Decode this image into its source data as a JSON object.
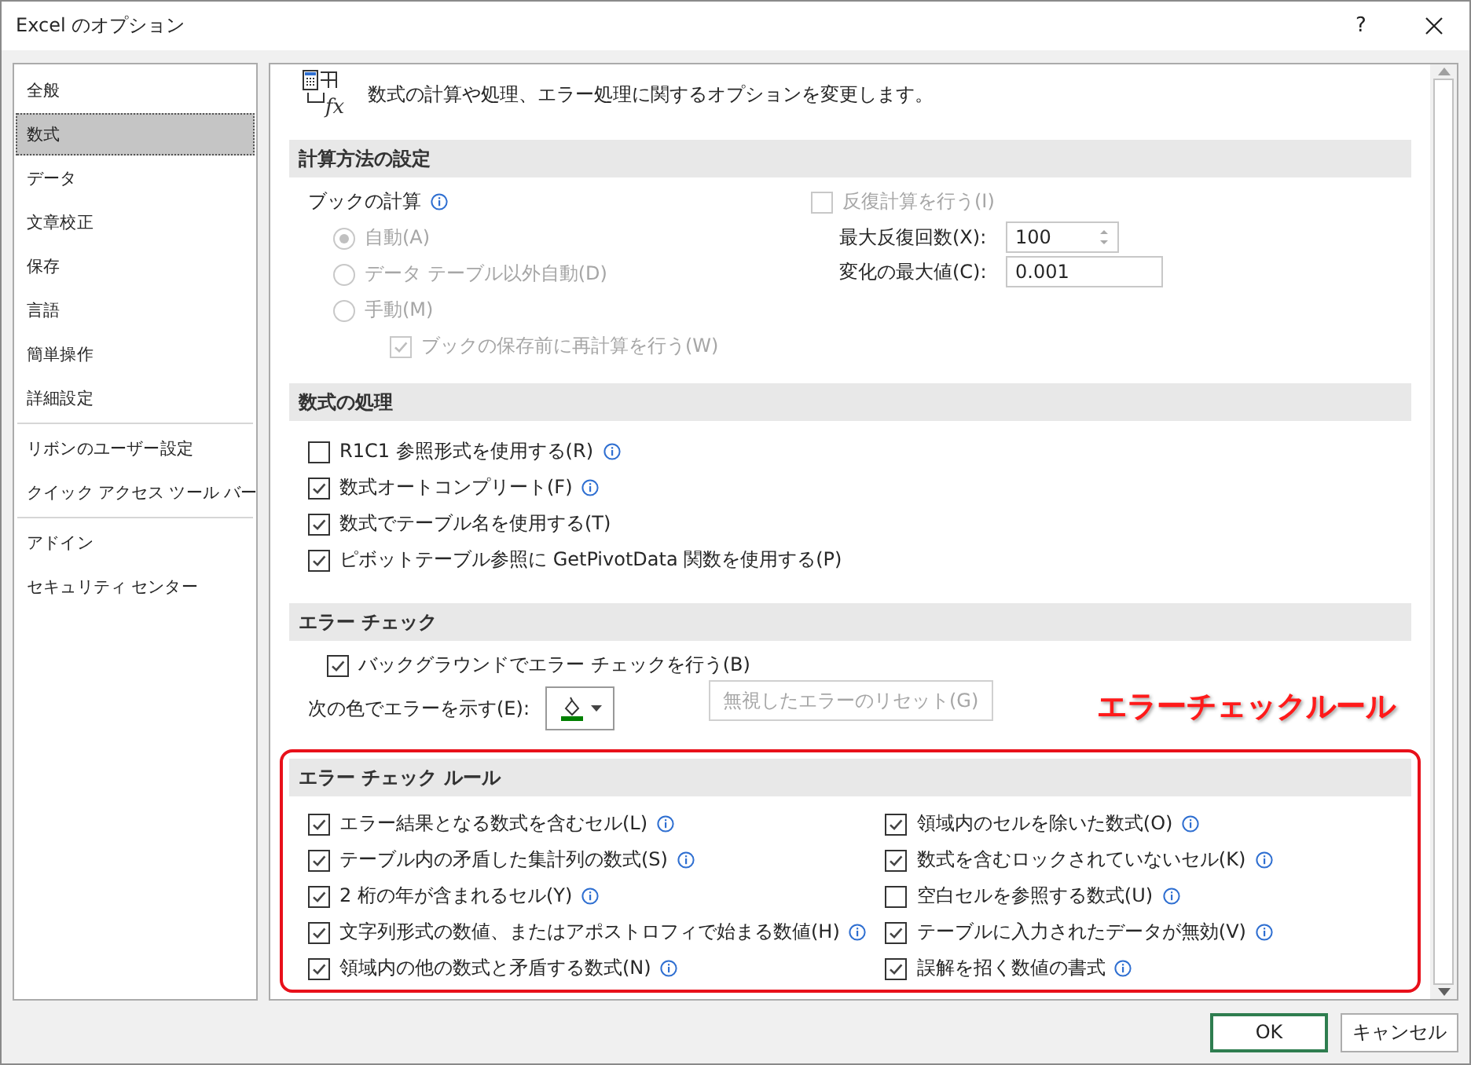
{
  "window": {
    "title": "Excel のオプション",
    "help": "?"
  },
  "sidebar": {
    "items": [
      {
        "label": "全般",
        "selected": false,
        "divider_after": false
      },
      {
        "label": "数式",
        "selected": true,
        "divider_after": false
      },
      {
        "label": "データ",
        "selected": false,
        "divider_after": false
      },
      {
        "label": "文章校正",
        "selected": false,
        "divider_after": false
      },
      {
        "label": "保存",
        "selected": false,
        "divider_after": false
      },
      {
        "label": "言語",
        "selected": false,
        "divider_after": false
      },
      {
        "label": "簡単操作",
        "selected": false,
        "divider_after": false
      },
      {
        "label": "詳細設定",
        "selected": false,
        "divider_after": true
      },
      {
        "label": "リボンのユーザー設定",
        "selected": false,
        "divider_after": false
      },
      {
        "label": "クイック アクセス ツール バー",
        "selected": false,
        "divider_after": true
      },
      {
        "label": "アドイン",
        "selected": false,
        "divider_after": false
      },
      {
        "label": "セキュリティ センター",
        "selected": false,
        "divider_after": false
      }
    ]
  },
  "header": {
    "icon_label": "fx",
    "text": "数式の計算や処理、エラー処理に関するオプションを変更します。"
  },
  "sections": [
    {
      "kind": "calc",
      "title": "計算方法の設定",
      "workbook_calc": {
        "label": "ブックの計算",
        "info": true,
        "options": [
          {
            "label": "自動(A)",
            "selected": true,
            "disabled": true
          },
          {
            "label": "データ テーブル以外自動(D)",
            "selected": false,
            "disabled": true
          },
          {
            "label": "手動(M)",
            "selected": false,
            "disabled": true
          }
        ],
        "recalc_before_save": {
          "label": "ブックの保存前に再計算を行う(W)",
          "checked": true,
          "disabled": true
        }
      },
      "iterative": {
        "label": "反復計算を行う(I)",
        "checked": false,
        "disabled": true
      },
      "fields": [
        {
          "label": "最大反復回数(X):",
          "value": "100",
          "kind": "spinner"
        },
        {
          "label": "変化の最大値(C):",
          "value": "0.001",
          "kind": "text"
        }
      ]
    },
    {
      "kind": "checklist",
      "title": "数式の処理",
      "items": [
        {
          "label": "R1C1 参照形式を使用する(R)",
          "checked": false,
          "info": true
        },
        {
          "label": "数式オートコンプリート(F)",
          "checked": true,
          "info": true
        },
        {
          "label": "数式でテーブル名を使用する(T)",
          "checked": true,
          "info": false
        },
        {
          "label": "ピボットテーブル参照に GetPivotData 関数を使用する(P)",
          "checked": true,
          "info": false
        }
      ]
    },
    {
      "kind": "errorcheck",
      "title": "エラー チェック",
      "background": {
        "label": "バックグラウンドでエラー チェックを行う(B)",
        "checked": true
      },
      "color_label": "次の色でエラーを示す(E):",
      "reset_button": {
        "label": "無視したエラーのリセット(G)",
        "disabled": true
      }
    },
    {
      "kind": "rules",
      "title": "エラー チェック ルール",
      "highlighted": true,
      "annotation": "エラーチェックルール",
      "columns": [
        [
          {
            "label": "エラー結果となる数式を含むセル(L)",
            "checked": true,
            "info": true
          },
          {
            "label": "テーブル内の矛盾した集計列の数式(S)",
            "checked": true,
            "info": true
          },
          {
            "label": "2 桁の年が含まれるセル(Y)",
            "checked": true,
            "info": true
          },
          {
            "label": "文字列形式の数値、またはアポストロフィで始まる数値(H)",
            "checked": true,
            "info": true
          },
          {
            "label": "領域内の他の数式と矛盾する数式(N)",
            "checked": true,
            "info": true
          }
        ],
        [
          {
            "label": "領域内のセルを除いた数式(O)",
            "checked": true,
            "info": true
          },
          {
            "label": "数式を含むロックされていないセル(K)",
            "checked": true,
            "info": true
          },
          {
            "label": "空白セルを参照する数式(U)",
            "checked": false,
            "info": true
          },
          {
            "label": "テーブルに入力されたデータが無効(V)",
            "checked": true,
            "info": true
          },
          {
            "label": "誤解を招く数値の書式",
            "checked": true,
            "info": true
          }
        ]
      ]
    }
  ],
  "buttons": [
    {
      "label": "OK",
      "default": true
    },
    {
      "label": "キャンセル",
      "default": false
    }
  ]
}
